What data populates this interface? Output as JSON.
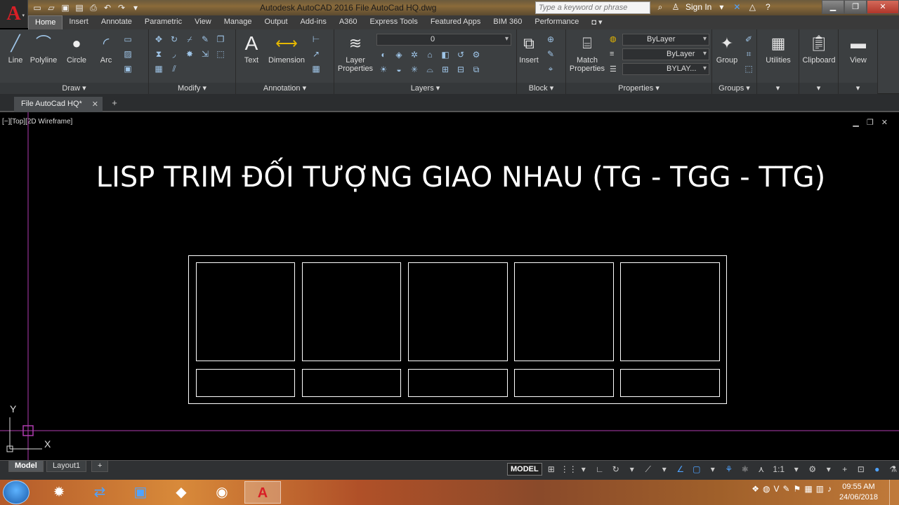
{
  "titlebar": {
    "app_menu_icon": "autocad-a-logo",
    "window_title": "Autodesk AutoCAD 2016    File AutoCad HQ.dwg",
    "search_placeholder": "Type a keyword or phrase",
    "sign_in": "Sign In"
  },
  "ribbon_tabs": [
    "Home",
    "Insert",
    "Annotate",
    "Parametric",
    "View",
    "Manage",
    "Output",
    "Add-ins",
    "A360",
    "Express Tools",
    "Featured Apps",
    "BIM 360",
    "Performance"
  ],
  "panels": {
    "draw": {
      "title": "Draw",
      "tools": [
        "Line",
        "Polyline",
        "Circle",
        "Arc"
      ]
    },
    "modify": {
      "title": "Modify"
    },
    "annotation": {
      "title": "Annotation",
      "tools": [
        "Text",
        "Dimension"
      ]
    },
    "layers": {
      "title": "Layers",
      "tool_line1": "Layer",
      "tool_line2": "Properties",
      "current_layer": "0"
    },
    "block": {
      "title": "Block",
      "tool": "Insert"
    },
    "properties": {
      "title": "Properties",
      "match_line1": "Match",
      "match_line2": "Properties",
      "color": "ByLayer",
      "linetype": "ByLayer",
      "lineweight": "BYLAY..."
    },
    "groups": {
      "title": "Groups",
      "tool": "Group"
    },
    "utilities": {
      "tool": "Utilities"
    },
    "clipboard": {
      "tool": "Clipboard"
    },
    "view": {
      "tool": "View"
    }
  },
  "document_tab": {
    "name": "File AutoCad HQ*"
  },
  "viewport": {
    "label": "[−][Top][2D Wireframe]",
    "drawing_text": "LISP TRIM ĐỐI TƯỢNG GIAO NHAU (TG  - TGG - TTG)",
    "ucs_x": "X",
    "ucs_y": "Y"
  },
  "layout_tabs": [
    "Model",
    "Layout1"
  ],
  "statusbar": {
    "model": "MODEL",
    "scale": "1:1"
  },
  "taskbar": {
    "time": "09:55 AM",
    "date": "24/06/2018"
  },
  "colors": {
    "ribbon_bg": "#3c3f41",
    "canvas_bg": "#000000",
    "crosshair": "#c040c0",
    "accent": "#d81f26"
  }
}
